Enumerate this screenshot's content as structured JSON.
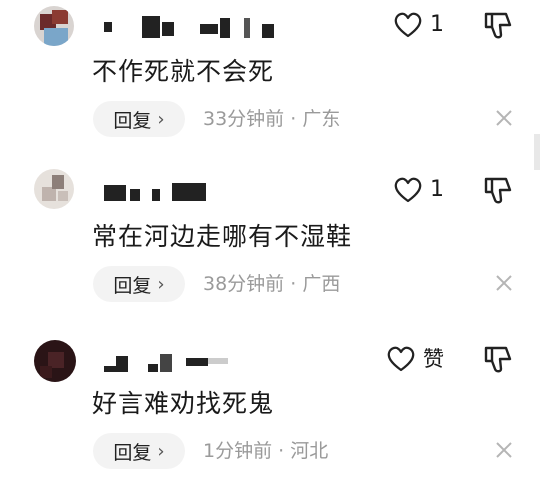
{
  "comments": [
    {
      "text": "不作死就不会死",
      "likes": "1",
      "reply_label": "回复",
      "time": "33分钟前",
      "location": "广东",
      "dot": "·"
    },
    {
      "text": "常在河边走哪有不湿鞋",
      "likes": "1",
      "reply_label": "回复",
      "time": "38分钟前",
      "location": "广西",
      "dot": "·"
    },
    {
      "text": "好言难劝找死鬼",
      "likes": "赞",
      "reply_label": "回复",
      "time": "1分钟前",
      "location": "河北",
      "dot": "·"
    }
  ],
  "icons": {
    "like": "heart-outline-icon",
    "dislike": "thumbs-down-outline-icon",
    "close": "close-icon",
    "chevron": "chevron-right-icon"
  },
  "colors": {
    "meta_text": "#9a9a9a",
    "reply_bg": "#f3f3f3",
    "text": "#1a1a1a"
  }
}
